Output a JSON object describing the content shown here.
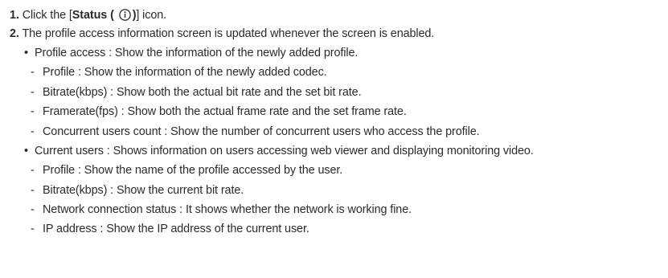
{
  "step1": {
    "number": "1.",
    "before": "Click the [",
    "bold_label": "Status (",
    "bold_close": ")",
    "after": "] icon.",
    "icon": "info-circle-icon"
  },
  "step2": {
    "number": "2.",
    "text": "The profile access information screen is updated whenever the screen is enabled."
  },
  "profile_access": {
    "bullet": "•",
    "text": "Profile access : Show the information of the newly added profile.",
    "items": [
      "Profile : Show the information of the newly added codec.",
      "Bitrate(kbps) : Show both the actual bit rate and the set bit rate.",
      "Framerate(fps) : Show both the actual frame rate and the set frame rate.",
      "Concurrent users count : Show the number of concurrent users who access the profile."
    ]
  },
  "current_users": {
    "bullet": "•",
    "text": "Current users : Shows information on users accessing web viewer and displaying monitoring video.",
    "items": [
      "Profile : Show the name of the profile accessed by the user.",
      "Bitrate(kbps) : Show the current bit rate.",
      "Network connection status : It shows whether the network is working fine.",
      "IP address : Show the IP address of the current user."
    ]
  },
  "dash": "-"
}
